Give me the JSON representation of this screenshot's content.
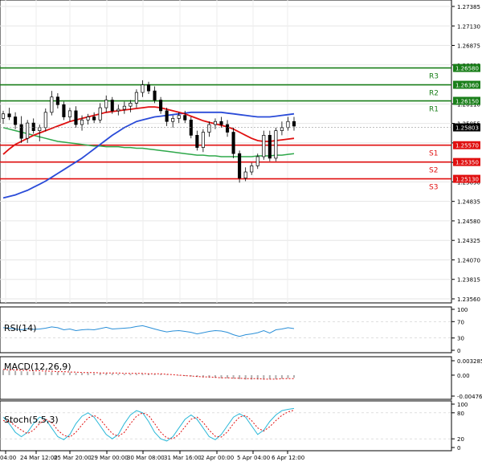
{
  "chart_data": {
    "type": "candlestick",
    "instrument_prices": {
      "main_ticks": [
        "1.27385",
        "1.27130",
        "1.26875",
        "1.26620",
        "1.26110",
        "1.25855",
        "1.25600",
        "1.25345",
        "1.25090",
        "1.24835",
        "1.24580",
        "1.24325",
        "1.24070",
        "1.23815",
        "1.23560"
      ],
      "y_range": [
        1.2356,
        1.27385
      ],
      "current_price": "1.25803",
      "levels": [
        {
          "name": "R3",
          "value": 1.2658,
          "label": "1.26580",
          "color": "#1a7f1a"
        },
        {
          "name": "R2",
          "value": 1.2636,
          "label": "1.26360",
          "color": "#1a7f1a"
        },
        {
          "name": "R1",
          "value": 1.2615,
          "label": "1.26150",
          "color": "#1a7f1a"
        },
        {
          "name": "S1",
          "value": 1.2557,
          "label": "1.25570",
          "color": "#e01010"
        },
        {
          "name": "S2",
          "value": 1.2535,
          "label": "1.25350",
          "color": "#e01010"
        },
        {
          "name": "S3",
          "value": 1.2513,
          "label": "1.25130",
          "color": "#e01010"
        }
      ]
    },
    "candles": [
      [
        1.2592,
        1.2602,
        1.2585,
        1.2598
      ],
      [
        1.2598,
        1.2606,
        1.259,
        1.2594
      ],
      [
        1.2594,
        1.26,
        1.2578,
        1.2584
      ],
      [
        1.2584,
        1.2595,
        1.256,
        1.2566
      ],
      [
        1.2566,
        1.259,
        1.256,
        1.2586
      ],
      [
        1.2586,
        1.2592,
        1.2572,
        1.2576
      ],
      [
        1.2576,
        1.2584,
        1.2562,
        1.258
      ],
      [
        1.258,
        1.2605,
        1.2575,
        1.26
      ],
      [
        1.26,
        1.2628,
        1.2596,
        1.262
      ],
      [
        1.262,
        1.2625,
        1.2605,
        1.261
      ],
      [
        1.261,
        1.2614,
        1.259,
        1.2594
      ],
      [
        1.2594,
        1.2606,
        1.2588,
        1.2602
      ],
      [
        1.2602,
        1.2608,
        1.258,
        1.2584
      ],
      [
        1.2584,
        1.2596,
        1.2576,
        1.259
      ],
      [
        1.259,
        1.2598,
        1.2584,
        1.2594
      ],
      [
        1.2594,
        1.26,
        1.2586,
        1.259
      ],
      [
        1.259,
        1.2612,
        1.2586,
        1.2606
      ],
      [
        1.2606,
        1.2622,
        1.26,
        1.2616
      ],
      [
        1.2616,
        1.262,
        1.2598,
        1.2602
      ],
      [
        1.2602,
        1.261,
        1.2596,
        1.2604
      ],
      [
        1.2604,
        1.2614,
        1.2598,
        1.2608
      ],
      [
        1.2608,
        1.2616,
        1.26,
        1.2612
      ],
      [
        1.2612,
        1.263,
        1.2606,
        1.2626
      ],
      [
        1.2626,
        1.2642,
        1.262,
        1.2636
      ],
      [
        1.2636,
        1.264,
        1.2624,
        1.2628
      ],
      [
        1.2628,
        1.2634,
        1.2612,
        1.2616
      ],
      [
        1.2616,
        1.262,
        1.2598,
        1.2602
      ],
      [
        1.2602,
        1.2606,
        1.2582,
        1.2588
      ],
      [
        1.2588,
        1.2596,
        1.258,
        1.2592
      ],
      [
        1.2592,
        1.26,
        1.2586,
        1.2596
      ],
      [
        1.2596,
        1.2602,
        1.2586,
        1.259
      ],
      [
        1.259,
        1.2594,
        1.2566,
        1.257
      ],
      [
        1.257,
        1.2576,
        1.255,
        1.2554
      ],
      [
        1.2554,
        1.2578,
        1.2548,
        1.2574
      ],
      [
        1.2574,
        1.2588,
        1.2568,
        1.2584
      ],
      [
        1.2584,
        1.2592,
        1.2578,
        1.2588
      ],
      [
        1.2588,
        1.2594,
        1.258,
        1.2584
      ],
      [
        1.2584,
        1.259,
        1.2568,
        1.2574
      ],
      [
        1.2574,
        1.258,
        1.254,
        1.2546
      ],
      [
        1.2546,
        1.255,
        1.2508,
        1.2514
      ],
      [
        1.2514,
        1.2528,
        1.251,
        1.2522
      ],
      [
        1.2522,
        1.2534,
        1.2518,
        1.253
      ],
      [
        1.253,
        1.2546,
        1.2526,
        1.2542
      ],
      [
        1.2542,
        1.2576,
        1.2538,
        1.257
      ],
      [
        1.257,
        1.2576,
        1.2536,
        1.254
      ],
      [
        1.254,
        1.258,
        1.2536,
        1.2576
      ],
      [
        1.2576,
        1.2588,
        1.257,
        1.258
      ],
      [
        1.258,
        1.2594,
        1.2576,
        1.2588
      ],
      [
        1.2588,
        1.2594,
        1.2576,
        1.2582
      ]
    ],
    "ma_red": [
      1.2545,
      1.2552,
      1.2558,
      1.2562,
      1.2566,
      1.257,
      1.2573,
      1.2576,
      1.2579,
      1.2582,
      1.2585,
      1.2588,
      1.259,
      1.2592,
      1.2594,
      1.2596,
      1.2598,
      1.26,
      1.2601,
      1.2602,
      1.2603,
      1.2604,
      1.2605,
      1.2606,
      1.2607,
      1.2607,
      1.2606,
      1.2604,
      1.2602,
      1.26,
      1.2598,
      1.2595,
      1.2592,
      1.2589,
      1.2587,
      1.2585,
      1.2583,
      1.2581,
      1.2578,
      1.2574,
      1.257,
      1.2566,
      1.2563,
      1.2562,
      1.2562,
      1.2563,
      1.2564,
      1.2565,
      1.2566
    ],
    "ma_blue": [
      1.2488,
      1.249,
      1.2492,
      1.2495,
      1.2498,
      1.2502,
      1.2506,
      1.251,
      1.2515,
      1.252,
      1.2525,
      1.253,
      1.2535,
      1.254,
      1.2546,
      1.2552,
      1.2558,
      1.2564,
      1.257,
      1.2575,
      1.258,
      1.2584,
      1.2588,
      1.259,
      1.2592,
      1.2594,
      1.2595,
      1.2596,
      1.2597,
      1.2598,
      1.2599,
      1.26,
      1.26,
      1.26,
      1.26,
      1.26,
      1.26,
      1.2599,
      1.2598,
      1.2597,
      1.2596,
      1.2595,
      1.2594,
      1.2594,
      1.2594,
      1.2595,
      1.2596,
      1.2597,
      1.2598
    ],
    "ma_green": [
      1.258,
      1.2578,
      1.2576,
      1.2574,
      1.2572,
      1.257,
      1.2568,
      1.2566,
      1.2564,
      1.2562,
      1.2561,
      1.256,
      1.2559,
      1.2558,
      1.2557,
      1.2556,
      1.2556,
      1.2555,
      1.2555,
      1.2555,
      1.2554,
      1.2554,
      1.2553,
      1.2553,
      1.2552,
      1.2551,
      1.255,
      1.2549,
      1.2548,
      1.2547,
      1.2546,
      1.2545,
      1.2544,
      1.2544,
      1.2543,
      1.2543,
      1.2542,
      1.2542,
      1.2542,
      1.2542,
      1.2542,
      1.2542,
      1.2543,
      1.2543,
      1.2543,
      1.2544,
      1.2544,
      1.2545,
      1.2546
    ],
    "x_labels": [
      "04:00",
      "24 Mar 12:00",
      "25 Mar 20:00",
      "29 Mar 00:00",
      "30 Mar 08:00",
      "31 Mar 16:00",
      "2 Apr 00:00",
      "5 Apr 04:00",
      "6 Apr 12:00"
    ],
    "rsi": {
      "label": "RSI(14)",
      "ticks": [
        "100",
        "70",
        "30",
        "0"
      ],
      "values": [
        55,
        54,
        52,
        50,
        53,
        51,
        52,
        54,
        57,
        55,
        50,
        52,
        48,
        50,
        51,
        50,
        53,
        56,
        52,
        53,
        54,
        55,
        58,
        60,
        56,
        52,
        48,
        45,
        47,
        48,
        46,
        44,
        40,
        43,
        46,
        48,
        47,
        44,
        38,
        34,
        38,
        40,
        43,
        48,
        42,
        50,
        52,
        55,
        53
      ]
    },
    "macd": {
      "label": "MACD(12,26,9)",
      "ticks": [
        "0.003285",
        "0.00",
        "-0.004769"
      ],
      "histogram": [
        0.0012,
        0.0011,
        0.001,
        0.0009,
        0.0008,
        0.0008,
        0.0007,
        0.0007,
        0.0007,
        0.0007,
        0.0006,
        0.0006,
        0.0005,
        0.0005,
        0.0005,
        0.0004,
        0.0004,
        0.0004,
        0.0004,
        0.0003,
        0.0003,
        0.0003,
        0.0003,
        0.0003,
        0.0003,
        0.0002,
        0.0002,
        0.0001,
        0.0,
        -0.0001,
        -0.0002,
        -0.0003,
        -0.0004,
        -0.0005,
        -0.0006,
        -0.0006,
        -0.0007,
        -0.0007,
        -0.0008,
        -0.0009,
        -0.001,
        -0.001,
        -0.001,
        -0.001,
        -0.0009,
        -0.0009,
        -0.0008,
        -0.0007,
        -0.0006
      ],
      "signal": [
        0.0013,
        0.0012,
        0.0012,
        0.0011,
        0.0011,
        0.001,
        0.001,
        0.0009,
        0.0009,
        0.0008,
        0.0008,
        0.0007,
        0.0007,
        0.0006,
        0.0006,
        0.0006,
        0.0005,
        0.0005,
        0.0005,
        0.0005,
        0.0004,
        0.0004,
        0.0004,
        0.0004,
        0.0003,
        0.0003,
        0.0003,
        0.0002,
        0.0001,
        0.0,
        -0.0001,
        -0.0002,
        -0.0003,
        -0.0004,
        -0.0004,
        -0.0005,
        -0.0006,
        -0.0006,
        -0.0007,
        -0.0007,
        -0.0008,
        -0.0008,
        -0.0008,
        -0.0009,
        -0.0009,
        -0.0009,
        -0.0008,
        -0.0008,
        -0.0008
      ]
    },
    "stoch": {
      "label": "Stoch(5,5,3)",
      "ticks": [
        "100",
        "80",
        "20",
        "0"
      ],
      "k": [
        70,
        55,
        35,
        25,
        35,
        55,
        70,
        65,
        45,
        25,
        18,
        30,
        55,
        72,
        80,
        70,
        50,
        30,
        20,
        30,
        55,
        75,
        85,
        80,
        60,
        35,
        20,
        15,
        25,
        45,
        65,
        75,
        65,
        45,
        25,
        18,
        30,
        50,
        70,
        78,
        70,
        50,
        30,
        40,
        60,
        75,
        85,
        88,
        90
      ],
      "d": [
        62,
        60,
        50,
        40,
        32,
        40,
        55,
        65,
        58,
        40,
        28,
        24,
        35,
        52,
        68,
        74,
        65,
        48,
        32,
        26,
        35,
        55,
        72,
        80,
        74,
        55,
        35,
        22,
        20,
        30,
        48,
        65,
        70,
        58,
        40,
        26,
        24,
        36,
        55,
        70,
        74,
        62,
        45,
        38,
        48,
        62,
        74,
        82,
        86
      ]
    },
    "grid": true
  },
  "colors": {
    "bull": "#1a7f1a",
    "bear": "#e01010",
    "ma_red": "#e01010",
    "ma_blue": "#2a4bd8",
    "ma_green": "#2ea84a",
    "rsi": "#2a8fd8",
    "stoch_k": "#2ab8d8",
    "stoch_d": "#e01010",
    "current": "#000000"
  }
}
